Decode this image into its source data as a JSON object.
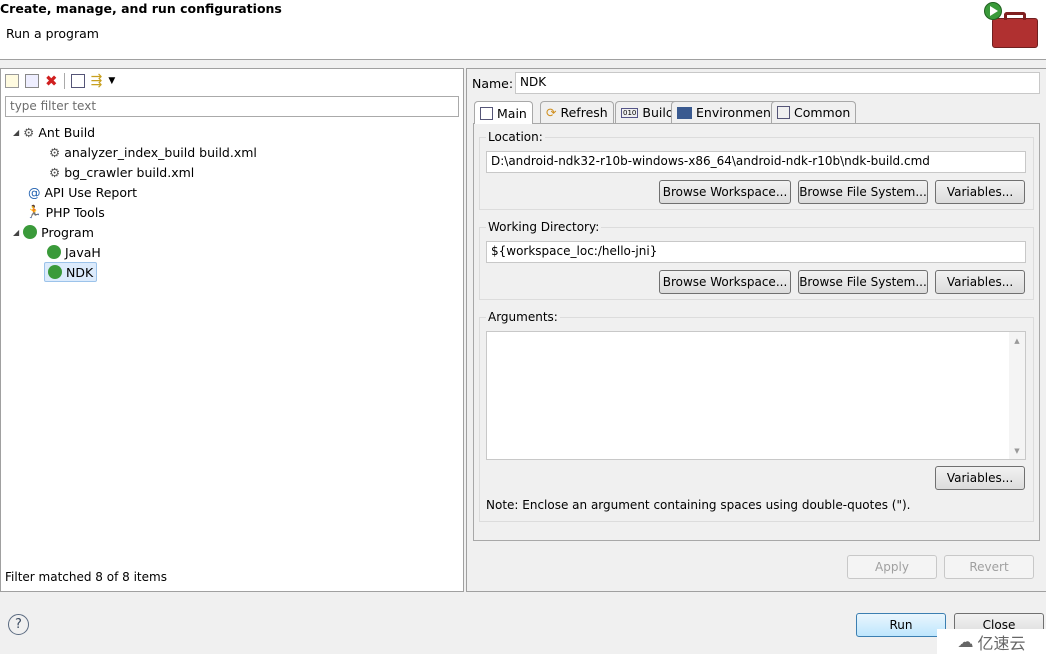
{
  "header": {
    "title": "Create, manage, and run configurations",
    "subtitle": "Run a program"
  },
  "left": {
    "filter_placeholder": "type filter text",
    "status": "Filter matched 8 of 8 items",
    "tree": [
      {
        "label": "Ant Build",
        "icon": "ant-icon"
      },
      {
        "label": "analyzer_index_build build.xml",
        "icon": "ant-icon"
      },
      {
        "label": "bg_crawler build.xml",
        "icon": "ant-icon"
      },
      {
        "label": "API Use Report",
        "icon": "api-report-icon"
      },
      {
        "label": "PHP Tools",
        "icon": "php-tools-icon"
      },
      {
        "label": "Program",
        "icon": "program-icon"
      },
      {
        "label": "JavaH",
        "icon": "program-icon"
      },
      {
        "label": "NDK",
        "icon": "program-icon",
        "selected": true
      }
    ]
  },
  "right": {
    "name_label": "Name:",
    "name_value": "NDK",
    "tabs": [
      {
        "label": "Main",
        "active": true
      },
      {
        "label": "Refresh"
      },
      {
        "label": "Build"
      },
      {
        "label": "Environment"
      },
      {
        "label": "Common"
      }
    ],
    "location_label": "Location:",
    "location_value": "D:\\android-ndk32-r10b-windows-x86_64\\android-ndk-r10b\\ndk-build.cmd",
    "workdir_label": "Working Directory:",
    "workdir_value": "${workspace_loc:/hello-jni}",
    "arguments_label": "Arguments:",
    "arguments_value": "",
    "browse_workspace": "Browse Workspace...",
    "browse_fs": "Browse File System...",
    "variables": "Variables...",
    "note": "Note: Enclose an argument containing spaces using double-quotes (\").",
    "apply": "Apply",
    "revert": "Revert"
  },
  "footer": {
    "run": "Run",
    "close": "Close",
    "help": "?"
  },
  "watermark": "亿速云"
}
